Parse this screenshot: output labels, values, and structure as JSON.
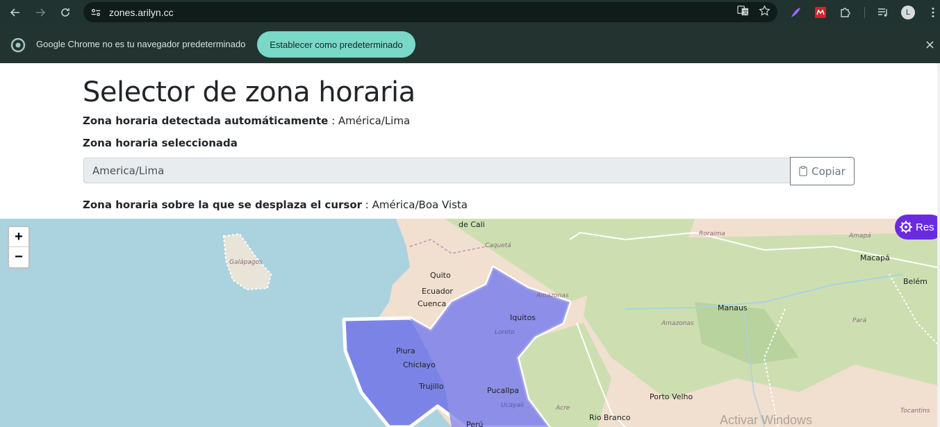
{
  "browser": {
    "url": "zones.arilyn.cc",
    "profile_initial": "L"
  },
  "infobar": {
    "message": "Google Chrome no es tu navegador predeterminado",
    "button_label": "Establecer como predeterminado"
  },
  "page": {
    "title": "Selector de zona horaria",
    "detected_label": "Zona horaria detectada automáticamente",
    "detected_value": " : América/Lima",
    "selected_label": "Zona horaria seleccionada",
    "selected_value": "America/Lima",
    "copy_label": "Copiar",
    "hover_label": "Zona horaria sobre la que se desplaza el cursor",
    "hover_value": " : América/Boa Vista"
  },
  "map": {
    "zoom_in": "+",
    "zoom_out": "−",
    "labels": {
      "cali": "de Cali",
      "caqueta": "Caquetá",
      "galapagos": "Galápagos",
      "quito": "Quito",
      "ecuador": "Ecuador",
      "cuenca": "Cuenca",
      "amazonas1": "Amazonas",
      "iquitos": "Iquitos",
      "loreto": "Loreto",
      "piura": "Piura",
      "chiclayo": "Chiclayo",
      "trujillo": "Trujillo",
      "pucallpa": "Pucallpa",
      "ucayali": "Ucayali",
      "peru": "Perú",
      "roraima": "Roraima",
      "amapa": "Amapá",
      "macapa": "Macapá",
      "belem": "Belém",
      "manaus": "Manaus",
      "amazonas2": "Amazonas",
      "para": "Pará",
      "porto_velho": "Porto Velho",
      "acre": "Acre",
      "rio_branco": "Rio Branco",
      "tocantins": "Tocantins"
    },
    "side_button": "Res",
    "watermark": "Activar Windows"
  }
}
